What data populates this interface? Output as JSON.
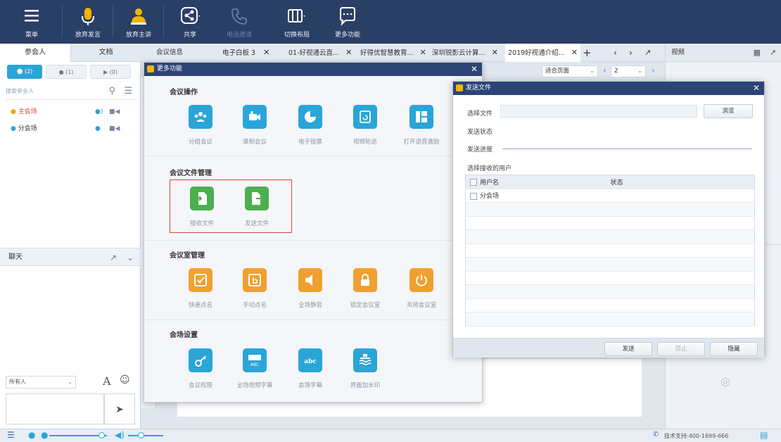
{
  "toolbar": {
    "items": [
      {
        "label": "菜单",
        "icon": "menu-icon"
      },
      {
        "label": "放弃发言",
        "icon": "microphone-icon"
      },
      {
        "label": "放弃主讲",
        "icon": "presenter-icon"
      },
      {
        "label": "共享",
        "icon": "share-icon"
      },
      {
        "label": "电话邀请",
        "icon": "phone-icon"
      },
      {
        "label": "切换布局",
        "icon": "layout-icon"
      },
      {
        "label": "更多功能",
        "icon": "more-icon"
      }
    ]
  },
  "left": {
    "tabs": [
      "参会人",
      "文档"
    ],
    "filters": [
      "(2)",
      "(1)",
      "(0)"
    ],
    "search_placeholder": "搜索参会人",
    "participants": [
      "主会场",
      "分会场"
    ],
    "chat_title": "聊天",
    "recipient": "所有人"
  },
  "center": {
    "tabs": [
      "会议信息",
      "电子白板 3",
      "01-好视通云直...",
      "好得优智慧教育...",
      "深圳锐影云计算...",
      "2019好视通介绍..."
    ],
    "page_fit": "适合页面",
    "page_num": "2",
    "video_label": "视频"
  },
  "modal": {
    "title": "更多功能",
    "sections": [
      {
        "title": "会议操作",
        "items": [
          "分组会议",
          "录制会议",
          "电子投票",
          "视频轮巡",
          "打开语音激励"
        ]
      },
      {
        "title": "会议文件管理",
        "items": [
          "接收文件",
          "发送文件"
        ]
      },
      {
        "title": "会议室管理",
        "items": [
          "快速点名",
          "手动点名",
          "全场静音",
          "锁定会议室",
          "关闭会议室"
        ]
      },
      {
        "title": "会场设置",
        "items": [
          "会议权限",
          "全场视频字幕",
          "会场字幕",
          "界面加水印"
        ]
      }
    ]
  },
  "send_dialog": {
    "title": "发送文件",
    "select_file_label": "选择文件",
    "browse": "浏览",
    "status_label": "发送状态",
    "progress_label": "发送进度",
    "recipients_label": "选择接收的用户",
    "col_user": "用户名",
    "col_status": "状态",
    "users": [
      "分会场"
    ],
    "btn_send": "发送",
    "btn_stop": "停止",
    "btn_hide": "隐藏"
  },
  "status": {
    "support": "技术支持:400-1699-666"
  },
  "colors": {
    "toolbar": "#2a3f66",
    "accent_blue": "#2aa5d8",
    "green": "#4caf50",
    "orange": "#f0a030",
    "highlight": "#d9473f"
  }
}
